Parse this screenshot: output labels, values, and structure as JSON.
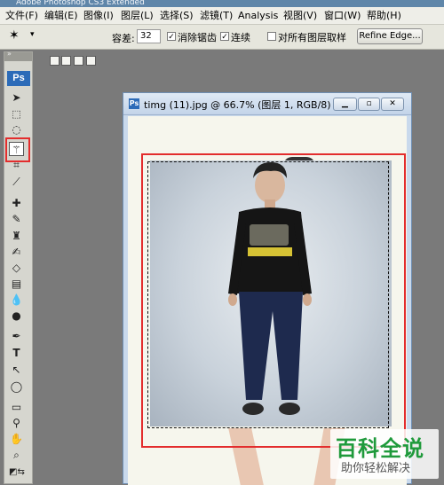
{
  "app": {
    "title": "Adobe Photoshop CS3 Extended"
  },
  "menubar": {
    "items": [
      "文件(F)",
      "编辑(E)",
      "图像(I)",
      "图层(L)",
      "选择(S)",
      "滤镜(T)",
      "Analysis",
      "视图(V)",
      "窗口(W)",
      "帮助(H)"
    ]
  },
  "options": {
    "tolerance_label": "容差:",
    "tolerance_value": "32",
    "antialias_label": "消除锯齿",
    "antialias_checked": true,
    "contiguous_label": "连续",
    "contiguous_checked": true,
    "sample_all_label": "对所有图层取样",
    "sample_all_checked": false,
    "refine_edge_label": "Refine Edge..."
  },
  "toolbox": {
    "logo": "Ps",
    "highlighted_tool": "magic-wand-tool"
  },
  "document": {
    "title": "timg (11).jpg @ 66.7% (图层 1, RGB/8)"
  },
  "watermark": {
    "title": "百科全说",
    "subtitle": "助你轻松解决"
  },
  "colors": {
    "highlight_red": "#e32d2d",
    "watermark_green": "#1f9a3b",
    "ps_blue": "#2c6bb8"
  }
}
